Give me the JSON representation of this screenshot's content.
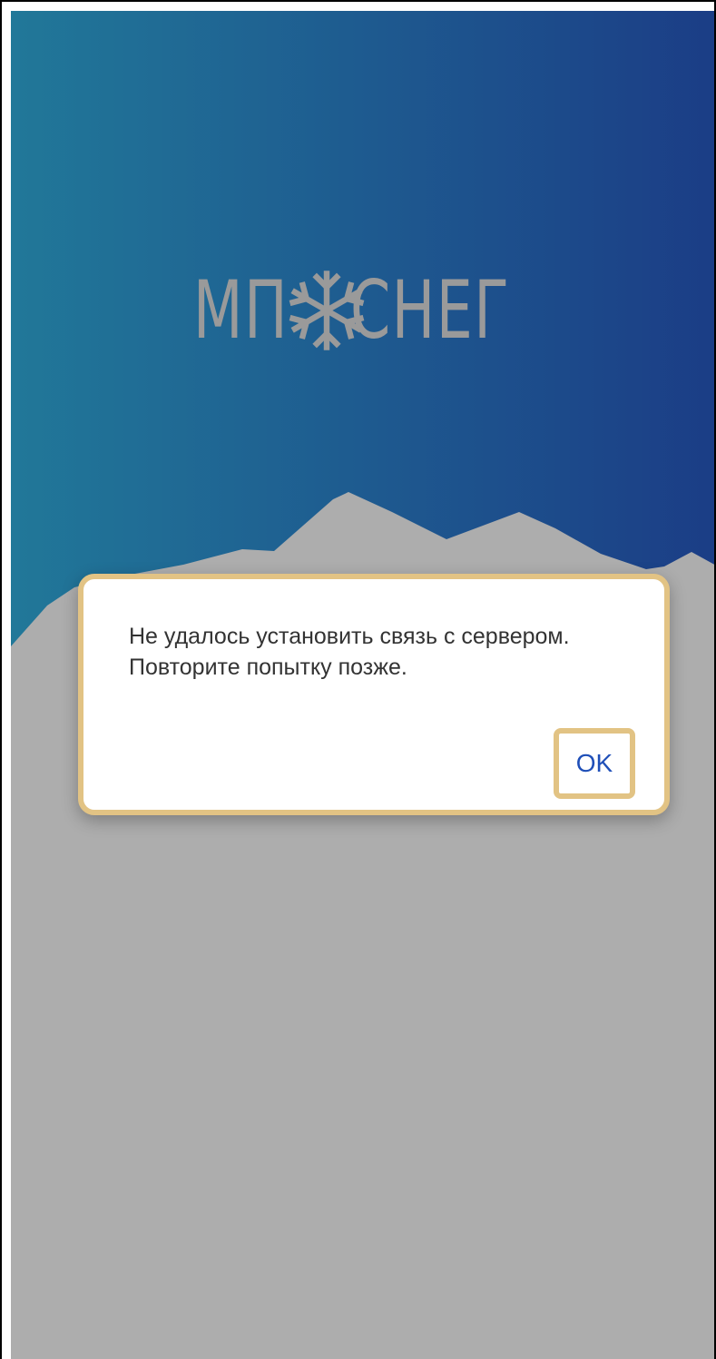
{
  "app": {
    "logo": {
      "left_text": "МП",
      "right_text": "СНЕГ",
      "icon": "snowflake-icon"
    }
  },
  "dialog": {
    "message": "Не удалось установить связь с сервером. Повторите попытку позже.",
    "ok_label": "OK"
  },
  "colors": {
    "gradient_start": "#217899",
    "gradient_end": "#1b3d86",
    "mountain": "#adadad",
    "logo": "#9a9a9a",
    "highlight": "#e2c384",
    "button_text": "#1f4fb8"
  }
}
